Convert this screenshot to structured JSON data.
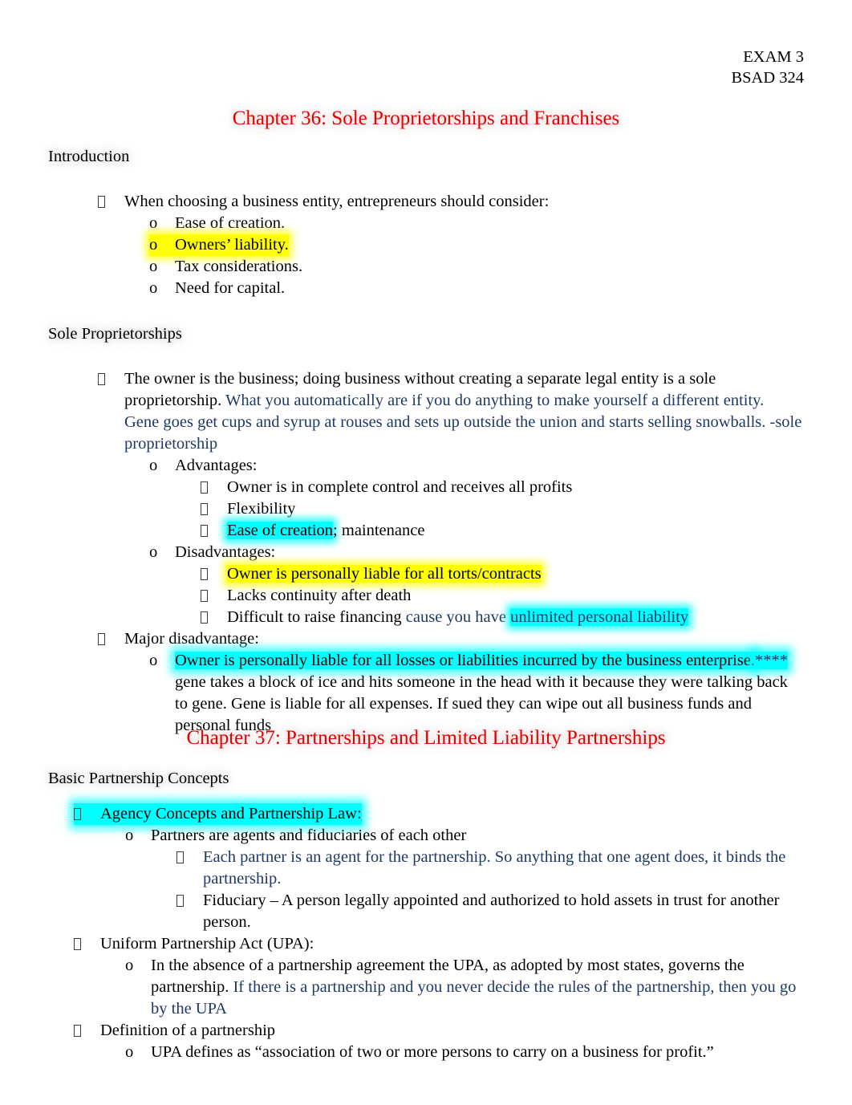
{
  "document": {
    "header": {
      "line1": "EXAM 3",
      "line2": "BSAD 324"
    },
    "colors": {
      "chapter_title": "#E60000",
      "annotation_blue": "#1F3864",
      "highlight_yellow": "#FFFF00",
      "highlight_cyan": "#00FFFF",
      "body_text": "#000000"
    },
    "chapter36": {
      "title": "Chapter 36: Sole Proprietorships and Franchises",
      "section_intro": {
        "heading": "Introduction",
        "bullet1": "When choosing a business entity, entrepreneurs should consider:",
        "sub1": "Ease of creation.",
        "sub2": "Owners’ liability.",
        "sub3": "Tax considerations.",
        "sub4": "Need for capital."
      },
      "section_sole": {
        "heading": "Sole Proprietorships",
        "bullet1_black": "The owner is the business; doing business without creating a separate legal entity is a sole proprietorship. ",
        "bullet1_blue": "What you automatically are if you do anything to make yourself a different entity. Gene goes get cups and syrup at rouses and sets up outside the union and starts selling snowballs. -sole proprietorship",
        "advantages_label": "Advantages:",
        "adv1": "Owner is in complete control and receives all profits",
        "adv2": "Flexibility",
        "adv3_hl": "Ease of creation",
        "adv3_rest": "; maintenance",
        "disadvantages_label": "Disadvantages:",
        "dis1": "Owner is personally liable for all torts/contracts",
        "dis2": "Lacks continuity after death",
        "dis3_black": "Difficult to raise financing ",
        "dis3_blue_plain": "cause you have ",
        "dis3_blue_hl": "unlimited personal liability",
        "major_label": "Major disadvantage:",
        "major_hl": "Owner is personally liable for all losses or liabilities incurred by the business enterprise.",
        "major_stars": "****",
        "major_rest": " gene takes a block of ice and hits someone in the head with it because they were talking back to gene. Gene is liable for all expenses. If sued they can wipe out all business funds and personal funds"
      }
    },
    "chapter37": {
      "title": "Chapter 37: Partnerships and Limited Liability Partnerships",
      "section_basic": {
        "heading": "Basic Partnership Concepts",
        "agency_label": "Agency Concepts and Partnership Law:",
        "agency_sub1": "Partners are agents and fiduciaries of each other",
        "agency_sub1_a": "Each partner is an agent for the partnership. So anything that one agent does, it binds the partnership.",
        "agency_sub1_b": "Fiduciary – A person legally appointed and authorized to hold assets in trust for another person.",
        "upa_label": "Uniform Partnership Act (UPA):",
        "upa_sub1_black": "In the absence of a partnership agreement the UPA, as adopted by most states, governs the partnership. ",
        "upa_sub1_blue": "If there is a partnership and you never decide the rules of the partnership, then you go by the UPA",
        "definition_label": "Definition of a partnership",
        "definition_sub1": "UPA defines as “association of two or more persons to carry on a business for profit.”"
      }
    },
    "markers": {
      "wingding": "",
      "circle_o": "o"
    }
  }
}
